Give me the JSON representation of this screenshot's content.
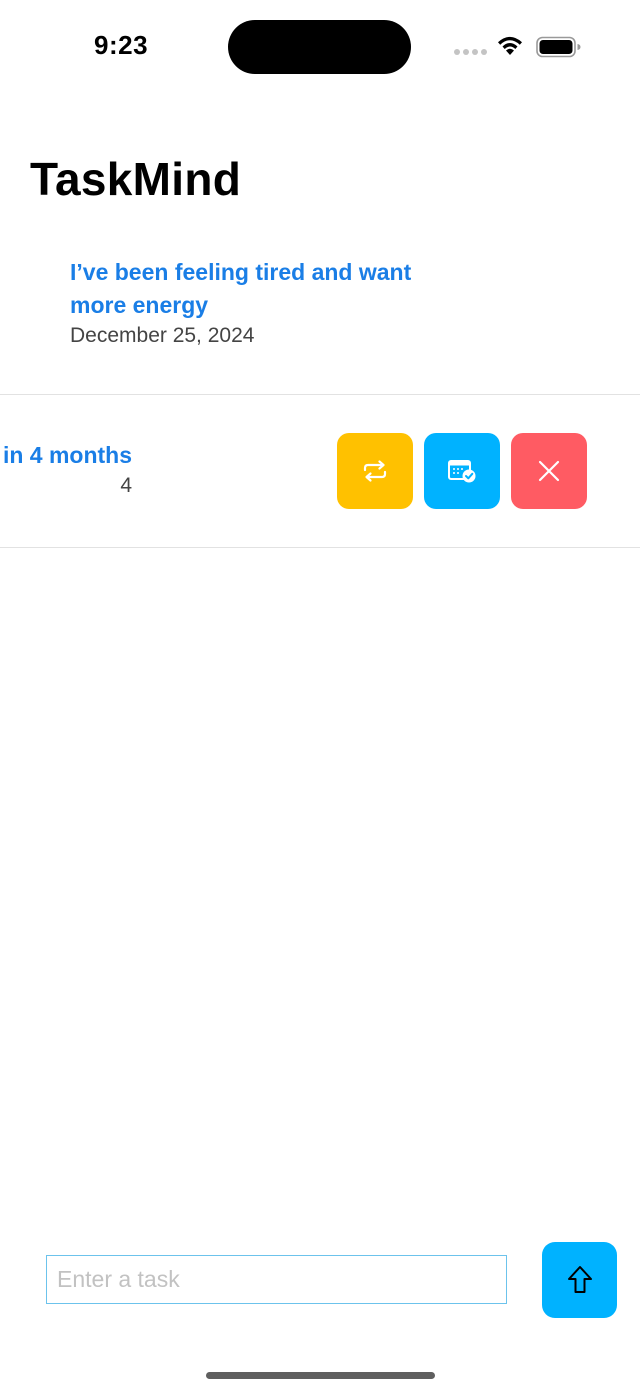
{
  "status_bar": {
    "time": "9:23",
    "wifi_icon": "wifi-icon",
    "battery_icon": "battery-icon"
  },
  "header": {
    "title": "TaskMind"
  },
  "tasks": [
    {
      "title": "I’ve been feeling tired and want more energy",
      "date": "December 25, 2024"
    },
    {
      "title": "in 4 months",
      "date": "4",
      "actions": {
        "repeat": {
          "icon": "repeat-icon",
          "color": "#ffc100"
        },
        "schedule": {
          "icon": "calendar-check-icon",
          "color": "#00b2ff"
        },
        "delete": {
          "icon": "close-icon",
          "color": "#ff5b63"
        }
      }
    }
  ],
  "composer": {
    "placeholder": "Enter a task",
    "value": "",
    "send_icon": "arrow-up-icon"
  },
  "colors": {
    "accent": "#00b2ff",
    "title_link": "#1a7ee6"
  }
}
